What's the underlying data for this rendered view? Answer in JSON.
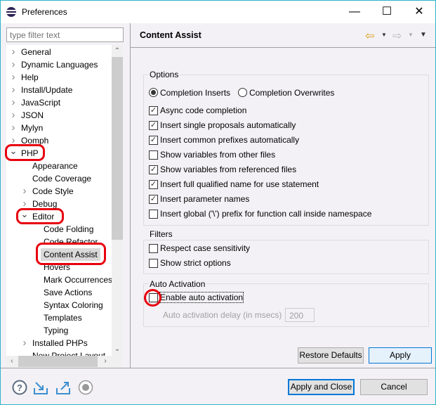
{
  "window": {
    "title": "Preferences",
    "minimize": "—",
    "maximize": "☐",
    "close": "✕"
  },
  "filter": {
    "placeholder": "type filter text"
  },
  "tree": [
    {
      "label": "General",
      "level": 0,
      "arrow": "collapsed"
    },
    {
      "label": "Dynamic Languages",
      "level": 0,
      "arrow": "collapsed"
    },
    {
      "label": "Help",
      "level": 0,
      "arrow": "collapsed"
    },
    {
      "label": "Install/Update",
      "level": 0,
      "arrow": "collapsed"
    },
    {
      "label": "JavaScript",
      "level": 0,
      "arrow": "collapsed"
    },
    {
      "label": "JSON",
      "level": 0,
      "arrow": "collapsed"
    },
    {
      "label": "Mylyn",
      "level": 0,
      "arrow": "collapsed"
    },
    {
      "label": "Oomph",
      "level": 0,
      "arrow": "collapsed"
    },
    {
      "label": "PHP",
      "level": 0,
      "arrow": "expanded",
      "highlighted": true
    },
    {
      "label": "Appearance",
      "level": 1,
      "arrow": "none"
    },
    {
      "label": "Code Coverage",
      "level": 1,
      "arrow": "none"
    },
    {
      "label": "Code Style",
      "level": 1,
      "arrow": "collapsed"
    },
    {
      "label": "Debug",
      "level": 1,
      "arrow": "collapsed"
    },
    {
      "label": "Editor",
      "level": 1,
      "arrow": "expanded",
      "highlighted": true
    },
    {
      "label": "Code Folding",
      "level": 2,
      "arrow": "none"
    },
    {
      "label": "Code Refactor",
      "level": 2,
      "arrow": "none"
    },
    {
      "label": "Content Assist",
      "level": 2,
      "arrow": "none",
      "selected": true,
      "highlighted": true
    },
    {
      "label": "Hovers",
      "level": 2,
      "arrow": "none"
    },
    {
      "label": "Mark Occurrences",
      "level": 2,
      "arrow": "none"
    },
    {
      "label": "Save Actions",
      "level": 2,
      "arrow": "none"
    },
    {
      "label": "Syntax Coloring",
      "level": 2,
      "arrow": "none"
    },
    {
      "label": "Templates",
      "level": 2,
      "arrow": "none"
    },
    {
      "label": "Typing",
      "level": 2,
      "arrow": "none"
    },
    {
      "label": "Installed PHPs",
      "level": 1,
      "arrow": "collapsed"
    },
    {
      "label": "New Project Layout",
      "level": 1,
      "arrow": "none"
    }
  ],
  "page": {
    "title": "Content Assist",
    "nav_icons": [
      "back-arrow-icon",
      "back-menu-icon",
      "forward-arrow-icon",
      "forward-menu-icon",
      "view-menu-icon"
    ],
    "options": {
      "label": "Options",
      "radios": [
        {
          "label": "Completion Inserts",
          "checked": true
        },
        {
          "label": "Completion Overwrites",
          "checked": false
        }
      ],
      "checkboxes": [
        {
          "label": "Async code completion",
          "checked": true
        },
        {
          "label": "Insert single proposals automatically",
          "checked": true
        },
        {
          "label": "Insert common prefixes automatically",
          "checked": true
        },
        {
          "label": "Show variables from other files",
          "checked": false
        },
        {
          "label": "Show variables from referenced files",
          "checked": true
        },
        {
          "label": "Insert full qualified name for use statement",
          "checked": true
        },
        {
          "label": "Insert parameter names",
          "checked": true
        },
        {
          "label": "Insert global ('\\') prefix for function call inside namespace",
          "checked": false
        }
      ]
    },
    "filters": {
      "label": "Filters",
      "checkboxes": [
        {
          "label": "Respect case sensitivity",
          "checked": false
        },
        {
          "label": "Show strict options",
          "checked": false
        }
      ]
    },
    "auto_activation": {
      "label": "Auto Activation",
      "enable": {
        "label": "Enable auto activation",
        "checked": false,
        "highlighted": true
      },
      "delay_label": "Auto activation delay (in msecs)",
      "delay_value": "200"
    },
    "restore_defaults": "Restore Defaults",
    "apply": "Apply"
  },
  "footer": {
    "icons": [
      "help-icon",
      "import-icon",
      "export-icon",
      "record-icon"
    ],
    "apply_close": "Apply and Close",
    "cancel": "Cancel"
  },
  "colors": {
    "annotation": "#e8000f",
    "accent": "#0078d7",
    "window_border": "#2bb3c8"
  }
}
